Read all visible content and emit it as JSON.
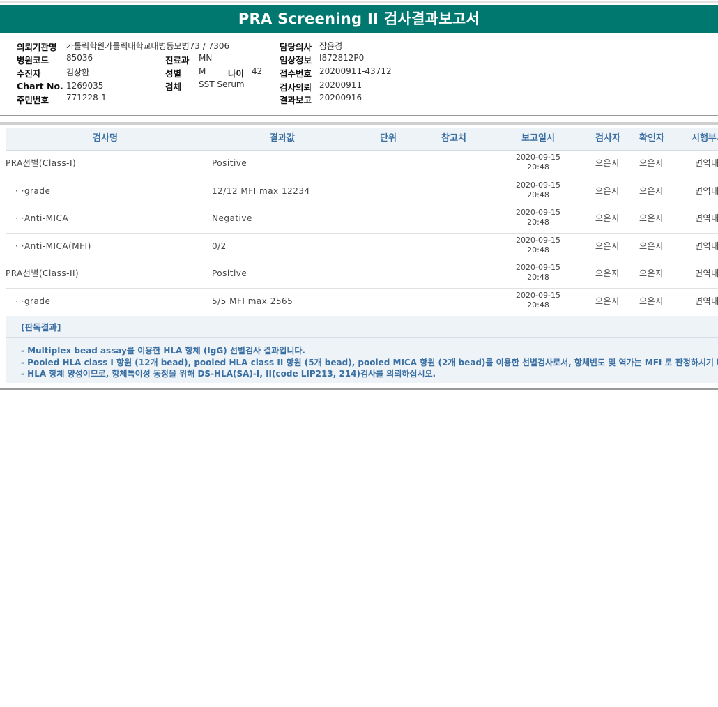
{
  "title": "PRA Screening II 검사결과보고서",
  "info": {
    "institution": {
      "label": "의뢰기관명",
      "value": "가톨릭학원가톨릭대학교대병동모병73 / 7306"
    },
    "hospital_code": {
      "label": "병원코드",
      "value": "85036"
    },
    "patient": {
      "label": "수진자",
      "value": "김상환"
    },
    "chart_no": {
      "label": "Chart No.",
      "value": "1269035"
    },
    "id_no": {
      "label": "주민번호",
      "value": "771228-1"
    },
    "department": {
      "label": "진료과",
      "value": "MN"
    },
    "sex": {
      "label": "성별",
      "value": "M"
    },
    "age": {
      "label": "나이",
      "value": "42"
    },
    "specimen": {
      "label": "검체",
      "value": "SST Serum"
    },
    "doctor": {
      "label": "담당의사",
      "value": "장윤경"
    },
    "clinical": {
      "label": "임상정보",
      "value": "I872812P0"
    },
    "receipt_no": {
      "label": "접수번호",
      "value": "20200911-43712"
    },
    "request_date": {
      "label": "검사의뢰",
      "value": "20200911"
    },
    "report_date": {
      "label": "결과보고",
      "value": "20200916"
    }
  },
  "table": {
    "headers": [
      "검사명",
      "결과값",
      "단위",
      "참고치",
      "보고일시",
      "검사자",
      "확인자",
      "시행부서"
    ],
    "rows": [
      {
        "name": "PRA선별(Class-I)",
        "result": "Positive",
        "unit": "",
        "ref": "",
        "date": "2020-09-15",
        "time": "20:48",
        "tester": "오은지",
        "checker": "오은지",
        "dept": "면역내"
      },
      {
        "name": "· ·grade",
        "result": "12/12 MFI max 12234",
        "unit": "",
        "ref": "",
        "date": "2020-09-15",
        "time": "20:48",
        "tester": "오은지",
        "checker": "오은지",
        "dept": "면역내"
      },
      {
        "name": "· ·Anti-MICA",
        "result": "Negative",
        "unit": "",
        "ref": "",
        "date": "2020-09-15",
        "time": "20:48",
        "tester": "오은지",
        "checker": "오은지",
        "dept": "면역내"
      },
      {
        "name": "· ·Anti-MICA(MFI)",
        "result": "0/2",
        "unit": "",
        "ref": "",
        "date": "2020-09-15",
        "time": "20:48",
        "tester": "오은지",
        "checker": "오은지",
        "dept": "면역내"
      },
      {
        "name": "PRA선별(Class-II)",
        "result": "Positive",
        "unit": "",
        "ref": "",
        "date": "2020-09-15",
        "time": "20:48",
        "tester": "오은지",
        "checker": "오은지",
        "dept": "면역내"
      },
      {
        "name": "· ·grade",
        "result": "5/5 MFI max 2565",
        "unit": "",
        "ref": "",
        "date": "2020-09-15",
        "time": "20:48",
        "tester": "오은지",
        "checker": "오은지",
        "dept": "면역내"
      }
    ]
  },
  "interpretation": {
    "title": "[판독결과]",
    "lines": [
      "- Multiplex bead assay를 이용한 HLA 항체 (IgG) 선별검사 결과입니다.",
      "- Pooled HLA class I 항원 (12개 bead), pooled HLA class II 항원 (5개 bead), pooled MICA 항원 (2개 bead)를 이용한 선별검사로서, 항체빈도 및 역가는 MFI 로 판정하시기 바랍니다.",
      "- HLA 항체 양성이므로, 항체특이성 동정을 위해 DS-HLA(SA)-I, II(code LIP213, 214)검사를 의뢰하십시오."
    ]
  }
}
